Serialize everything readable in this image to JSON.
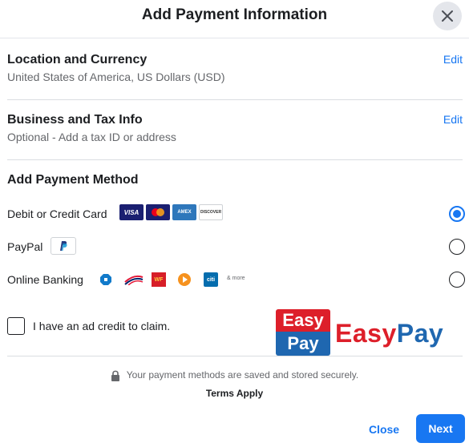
{
  "header": {
    "title": "Add Payment Information"
  },
  "location": {
    "title": "Location and Currency",
    "subtitle": "United States of America, US Dollars (USD)",
    "edit_label": "Edit"
  },
  "business": {
    "title": "Business and Tax Info",
    "subtitle": "Optional - Add a tax ID or address",
    "edit_label": "Edit"
  },
  "payment_method": {
    "title": "Add Payment Method",
    "options": [
      {
        "label": "Debit or Credit Card",
        "selected": true
      },
      {
        "label": "PayPal",
        "selected": false
      },
      {
        "label": "Online Banking",
        "selected": false
      }
    ],
    "card_logos": {
      "visa": "VISA",
      "amex": "AMEX",
      "discover": "DISCOVER"
    },
    "bank_logos": {
      "wf": "WF",
      "citi": "citi"
    },
    "more_label": "& more"
  },
  "ad_credit": {
    "label": "I have an ad credit to claim.",
    "checked": false
  },
  "easypay": {
    "badge_top": "Easy",
    "badge_bottom": "Pay",
    "word_1": "Easy",
    "word_2": "Pay"
  },
  "footer": {
    "secure_text": "Your payment methods are saved and stored securely.",
    "terms_label": "Terms Apply",
    "close_label": "Close",
    "next_label": "Next"
  },
  "colors": {
    "accent": "#1877f2",
    "easypay_red": "#dd1f2a",
    "easypay_blue": "#1f67b0"
  }
}
